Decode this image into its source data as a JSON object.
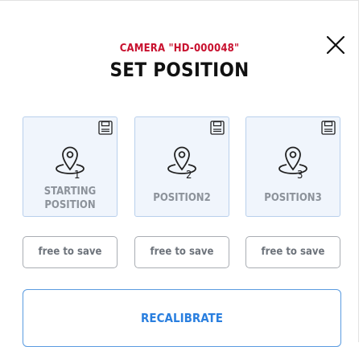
{
  "dialog": {
    "camera_label": "CAMERA \"HD-000048\"",
    "title": "SET POSITION",
    "close_icon": "close-icon"
  },
  "positions": [
    {
      "number": "1",
      "name_line1": "STARTING",
      "name_line2": "POSITION",
      "icon": "location-pin-icon",
      "save_icon": "floppy-disk-icon",
      "save_label": "free to save"
    },
    {
      "number": "2",
      "name_line1": "POSITION2",
      "icon": "location-pin-icon",
      "save_icon": "floppy-disk-icon",
      "save_label": "free to save"
    },
    {
      "number": "3",
      "name_line1": "POSITION3",
      "icon": "location-pin-icon",
      "save_icon": "floppy-disk-icon",
      "save_label": "free to save"
    }
  ],
  "actions": {
    "recalibrate_label": "RECALIBRATE"
  },
  "colors": {
    "accent_red": "#c8102e",
    "accent_blue": "#2a7fdf",
    "card_bg": "#f0f5fc",
    "card_border": "#b9d0ec",
    "muted_text": "#8c929a"
  }
}
